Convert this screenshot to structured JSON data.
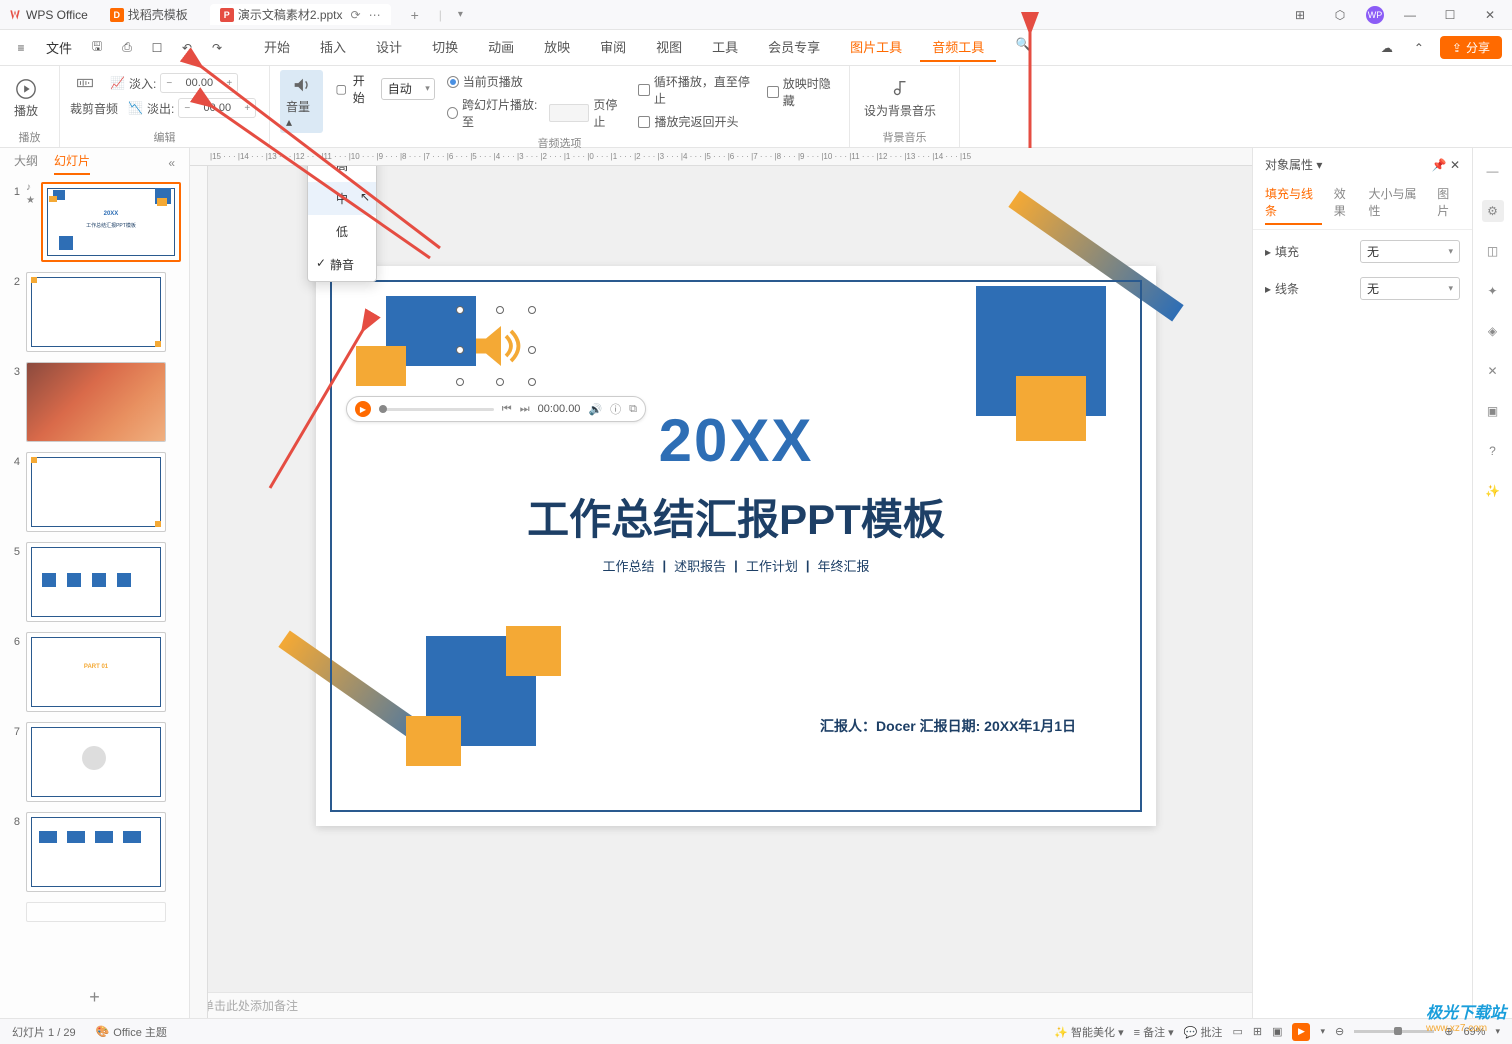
{
  "titlebar": {
    "app_name": "WPS Office",
    "tabs": [
      {
        "label": "找稻壳模板",
        "icon": "orange"
      },
      {
        "label": "演示文稿素材2.pptx",
        "icon": "red"
      }
    ],
    "avatar": "WP"
  },
  "menubar": {
    "file": "文件",
    "tabs": [
      "开始",
      "插入",
      "设计",
      "切换",
      "动画",
      "放映",
      "审阅",
      "视图",
      "工具",
      "会员专享",
      "图片工具",
      "音频工具"
    ],
    "active_tab": "音频工具",
    "highlighted_tabs": [
      "图片工具",
      "音频工具"
    ],
    "share": "分享"
  },
  "ribbon": {
    "play_group": {
      "play": "播放",
      "label": "播放"
    },
    "edit_group": {
      "crop": "裁剪音频",
      "fade_in": "淡入:",
      "fade_out": "淡出:",
      "fade_in_val": "00.00",
      "fade_out_val": "00.00",
      "label": "编辑"
    },
    "volume_group": {
      "volume": "音量",
      "start": "开始",
      "start_combo": "自动",
      "radio_current": "当前页播放",
      "radio_cross": "跨幻灯片播放: 至",
      "check_loop": "循环播放，直至停止",
      "check_hide": "放映时隐藏",
      "page_stop": "页停止",
      "check_rewind": "播放完返回开头",
      "label": "音频选项"
    },
    "bg_group": {
      "bg_music": "设为背景音乐",
      "label": "背景音乐"
    }
  },
  "volume_menu": {
    "items": [
      "高",
      "中",
      "低",
      "静音"
    ],
    "hovered": "中",
    "checked": "静音"
  },
  "left_panel": {
    "tab_outline": "大纲",
    "tab_slides": "幻灯片"
  },
  "slide": {
    "year": "20XX",
    "title": "工作总结汇报PPT模板",
    "subs": [
      "工作总结",
      "述职报告",
      "工作计划",
      "年终汇报"
    ],
    "footer": "汇报人：Docer 汇报日期: 20XX年1月1日",
    "audio_time": "00:00.00"
  },
  "right_panel": {
    "header": "对象属性",
    "tabs": [
      "填充与线条",
      "效果",
      "大小与属性",
      "图片"
    ],
    "active_tab": "填充与线条",
    "fill_label": "填充",
    "line_label": "线条",
    "none": "无"
  },
  "notes": {
    "placeholder": "单击此处添加备注"
  },
  "statusbar": {
    "slide_info": "幻灯片 1 / 29",
    "theme": "Office 主题",
    "smart_beautify": "智能美化",
    "notes": "备注",
    "comments": "批注",
    "zoom": "69%"
  },
  "watermark": {
    "name": "极光下载站",
    "url": "www.xz7.com"
  },
  "thumb_labels": {
    "t1_year": "20XX",
    "t1_title": "工作总结汇报PPT模板"
  },
  "thumbnails": [
    1,
    2,
    3,
    4,
    5,
    6,
    7,
    8
  ]
}
